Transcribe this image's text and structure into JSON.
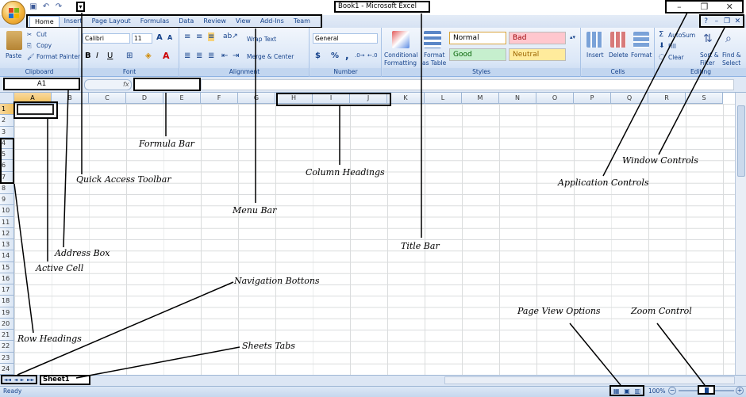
{
  "title_bar": {
    "title": "Book1 - Microsoft Excel"
  },
  "window_controls": {
    "minimize": "–",
    "restore": "❐",
    "close": "✕"
  },
  "app_controls": {
    "help": "?",
    "minimize": "–",
    "restore": "❐",
    "close": "✕"
  },
  "quick_access": {
    "save_icon": "save-icon",
    "undo_icon": "undo-icon",
    "redo_icon": "redo-icon",
    "more": "▾"
  },
  "menu": {
    "tabs": [
      "Home",
      "Insert",
      "Page Layout",
      "Formulas",
      "Data",
      "Review",
      "View",
      "Add-Ins",
      "Team"
    ]
  },
  "ribbon": {
    "clipboard": {
      "label": "Clipboard",
      "paste": "Paste",
      "cut": "Cut",
      "copy": "Copy",
      "format_painter": "Format Painter"
    },
    "font": {
      "label": "Font",
      "name": "Calibri",
      "size": "11",
      "bold": "B",
      "italic": "I",
      "underline": "U"
    },
    "alignment": {
      "label": "Alignment",
      "wrap": "Wrap Text",
      "merge": "Merge & Center"
    },
    "number": {
      "label": "Number",
      "format": "General",
      "currency": "$",
      "percent": "%",
      "comma": ","
    },
    "styles": {
      "label": "Styles",
      "conditional": "Conditional",
      "conditional2": "Formatting",
      "format_as": "Format",
      "format_as2": "as Table",
      "normal": "Normal",
      "bad": "Bad",
      "good": "Good",
      "neutral": "Neutral"
    },
    "cells": {
      "label": "Cells",
      "insert": "Insert",
      "delete": "Delete",
      "format": "Format"
    },
    "editing": {
      "label": "Editing",
      "autosum": "AutoSum",
      "fill": "Fill",
      "clear": "Clear",
      "sort": "Sort &",
      "sort2": "Filter",
      "find": "Find &",
      "find2": "Select"
    }
  },
  "formula_bar": {
    "name_box": "A1",
    "fx": "fx"
  },
  "columns": [
    "A",
    "B",
    "C",
    "D",
    "E",
    "F",
    "G",
    "H",
    "I",
    "J",
    "K",
    "L",
    "M",
    "N",
    "O",
    "P",
    "Q",
    "R",
    "S"
  ],
  "rows": [
    "1",
    "2",
    "3",
    "4",
    "5",
    "6",
    "7",
    "8",
    "9",
    "10",
    "11",
    "12",
    "13",
    "14",
    "15",
    "16",
    "17",
    "18",
    "19",
    "20",
    "21",
    "22",
    "23",
    "24"
  ],
  "sheet": {
    "tab": "Sheet1",
    "nav": [
      "◄◄",
      "◄",
      "►",
      "►►"
    ]
  },
  "status": {
    "ready": "Ready",
    "zoom": "100%",
    "minus": "−",
    "plus": "+"
  },
  "annotations": {
    "formula_bar": "Formula Bar",
    "quick_access_toolbar": "Quick Access Toolbar",
    "column_headings": "Column Headings",
    "window_controls": "Window Controls",
    "application_controls": "Application Controls",
    "menu_bar": "Menu Bar",
    "address_box": "Address Box",
    "title_bar": "Title Bar",
    "active_cell": "Active Cell",
    "navigation_buttons": "Navigation Bottons",
    "page_view_options": "Page View Options",
    "zoom_control": "Zoom Control",
    "sheets_tabs": "Sheets Tabs",
    "row_headings": "Row Headings"
  }
}
